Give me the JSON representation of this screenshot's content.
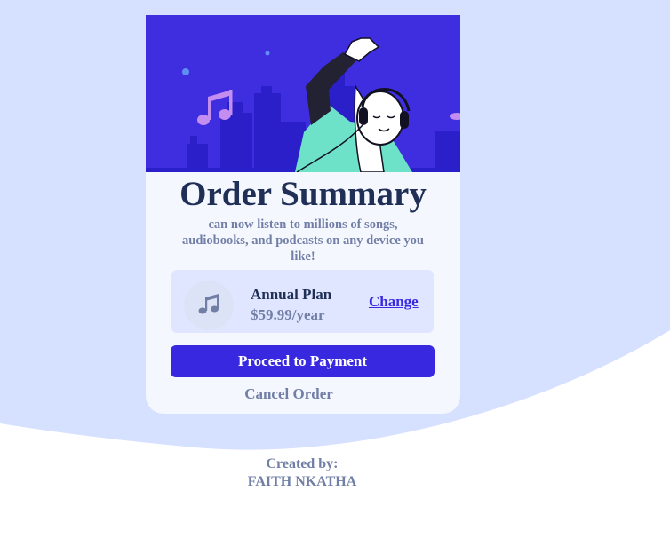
{
  "colors": {
    "background_wave": "#d6e0ff",
    "card": "#f5f7ff",
    "hero_blue": "#3f2ee0",
    "accent": "#3829e0",
    "heading": "#1f2f56",
    "muted": "#717fa6",
    "plan_box": "#e0e6ff"
  },
  "hero": {
    "illustration": "music-listener-illustration"
  },
  "card": {
    "title": "Order Summary",
    "description": "can now listen to millions of songs, audiobooks, and podcasts on any device you like!"
  },
  "plan": {
    "icon": "music-note-icon",
    "name": "Annual Plan",
    "price": "$59.99/year",
    "change_label": "Change"
  },
  "actions": {
    "proceed_label": "Proceed to Payment",
    "cancel_label": "Cancel Order"
  },
  "credits": {
    "line1": "Created by:",
    "line2": "FAITH NKATHA"
  }
}
